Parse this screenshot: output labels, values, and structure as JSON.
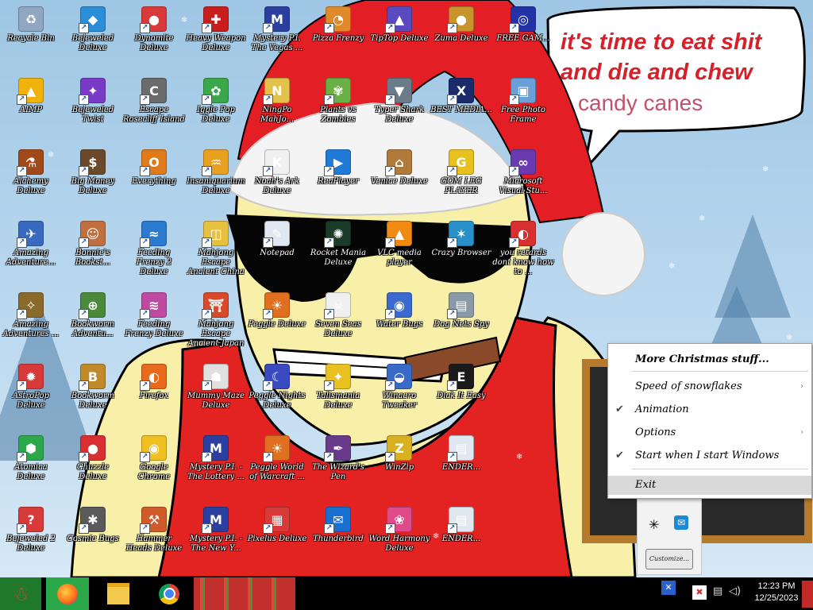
{
  "desktop": {
    "icons": [
      {
        "label": "Recycle Bin",
        "icon": "recycle-bin-icon",
        "color": "#8fa7c0",
        "glyph": "♻"
      },
      {
        "label": "Bejeweled Deluxe",
        "icon": "bejeweled-icon",
        "color": "#2a8fd8",
        "glyph": "◆"
      },
      {
        "label": "Dynomite Deluxe",
        "icon": "dynomite-icon",
        "color": "#d83a3a",
        "glyph": "●"
      },
      {
        "label": "Heavy Weapon Deluxe",
        "icon": "heavy-weapon-icon",
        "color": "#c81e1e",
        "glyph": "✚"
      },
      {
        "label": "Mystery P.I. The Vegas ...",
        "icon": "mystery-pi-icon",
        "color": "#2b3fa0",
        "glyph": "M"
      },
      {
        "label": "Pizza Frenzy",
        "icon": "pizza-icon",
        "color": "#e08a2a",
        "glyph": "◔"
      },
      {
        "label": "TipTop Deluxe",
        "icon": "tiptop-icon",
        "color": "#5a4ac0",
        "glyph": "▲"
      },
      {
        "label": "Zuma Deluxe",
        "icon": "zuma-icon",
        "color": "#c9942b",
        "glyph": "●"
      },
      {
        "label": "FREE GAM...",
        "icon": "free-games-icon",
        "color": "#2432a8",
        "glyph": "◎"
      },
      {
        "label": "AIMP",
        "icon": "aimp-icon",
        "color": "#f2b20c",
        "glyph": "▲"
      },
      {
        "label": "Bejeweled Twist",
        "icon": "bejeweled-twist-icon",
        "color": "#7a3ac8",
        "glyph": "✦"
      },
      {
        "label": "Escape Rosecliff Island",
        "icon": "escape-rosecliff-icon",
        "color": "#6b6b6b",
        "glyph": "C"
      },
      {
        "label": "Iggle Pop Deluxe",
        "icon": "iggle-pop-icon",
        "color": "#3aa84a",
        "glyph": "✿"
      },
      {
        "label": "NingPo MahJo...",
        "icon": "ningpo-icon",
        "color": "#e4c14a",
        "glyph": "N"
      },
      {
        "label": "Plants vs Zombies",
        "icon": "plants-zombies-icon",
        "color": "#6bb044",
        "glyph": "✾"
      },
      {
        "label": "Typer Shark Deluxe",
        "icon": "typer-shark-icon",
        "color": "#6a7b8a",
        "glyph": "▼"
      },
      {
        "label": "BEST MEDIA...",
        "icon": "xm-player-icon",
        "color": "#1a2a6a",
        "glyph": "X"
      },
      {
        "label": "Free Photo Frame",
        "icon": "photo-frame-icon",
        "color": "#6aa0d8",
        "glyph": "▣"
      },
      {
        "label": "Alchemy Deluxe",
        "icon": "alchemy-icon",
        "color": "#a04a1a",
        "glyph": "⚗"
      },
      {
        "label": "Big Money Deluxe",
        "icon": "big-money-icon",
        "color": "#6a4a2a",
        "glyph": "$"
      },
      {
        "label": "Everything",
        "icon": "everything-icon",
        "color": "#e07a1a",
        "glyph": "O"
      },
      {
        "label": "Insaniquarium Deluxe",
        "icon": "insaniquarium-icon",
        "color": "#e8a020",
        "glyph": "♒"
      },
      {
        "label": "Noah's Ark Deluxe",
        "icon": "noahs-ark-icon",
        "color": "#f0f0f0",
        "glyph": "K"
      },
      {
        "label": "ReaPlayer",
        "icon": "realplayer-icon",
        "color": "#1f7ad8",
        "glyph": "▶"
      },
      {
        "label": "Venice Deluxe",
        "icon": "venice-icon",
        "color": "#b07a3a",
        "glyph": "⌂"
      },
      {
        "label": "GOM LEG PLAYER",
        "icon": "gom-player-icon",
        "color": "#e8c020",
        "glyph": "G"
      },
      {
        "label": "Microsoft Visual Stu...",
        "icon": "visual-studio-icon",
        "color": "#6a3ab0",
        "glyph": "∞"
      },
      {
        "label": "Amazing Adventure...",
        "icon": "amazing-adventures-icon",
        "color": "#3a6ac0",
        "glyph": "✈"
      },
      {
        "label": "Bonnie's Bookst...",
        "icon": "bonnies-bookstore-icon",
        "color": "#c07040",
        "glyph": "☺"
      },
      {
        "label": "Feeding Frenzy 2 Deluxe",
        "icon": "feeding-frenzy-2-icon",
        "color": "#2a7ad0",
        "glyph": "≈"
      },
      {
        "label": "Mahjong Escape Ancient China",
        "icon": "mahjong-china-icon",
        "color": "#e8c040",
        "glyph": "◫"
      },
      {
        "label": "Notepad",
        "icon": "notepad-icon",
        "color": "#dfe8f0",
        "glyph": "✎"
      },
      {
        "label": "Rocket Mania Deluxe",
        "icon": "rocket-mania-icon",
        "color": "#1a3a2a",
        "glyph": "✺"
      },
      {
        "label": "VLC media player",
        "icon": "vlc-icon",
        "color": "#f08a10",
        "glyph": "▲"
      },
      {
        "label": "Crazy Browser",
        "icon": "crazy-browser-icon",
        "color": "#2a90c8",
        "glyph": "✶"
      },
      {
        "label": "you retards dont know how to ...",
        "icon": "firefox-shortcut-icon",
        "color": "#d83030",
        "glyph": "◐"
      },
      {
        "label": "Amazing Adventures ...",
        "icon": "amazing-adventures-2-icon",
        "color": "#8a6a2a",
        "glyph": "✧"
      },
      {
        "label": "Bookworm Adventu...",
        "icon": "bookworm-adventures-icon",
        "color": "#4a8a3a",
        "glyph": "⊕"
      },
      {
        "label": "Feeding Frenzy Deluxe",
        "icon": "feeding-frenzy-icon",
        "color": "#c04aa0",
        "glyph": "≋"
      },
      {
        "label": "Mahjong Escape Ancient Japan",
        "icon": "mahjong-japan-icon",
        "color": "#d84a2a",
        "glyph": "⛩"
      },
      {
        "label": "Peggle Deluxe",
        "icon": "peggle-icon",
        "color": "#e07020",
        "glyph": "☀"
      },
      {
        "label": "Seven Seas Deluxe",
        "icon": "seven-seas-icon",
        "color": "#f0f0f0",
        "glyph": "☠"
      },
      {
        "label": "Water Bugs",
        "icon": "water-bugs-icon",
        "color": "#3a6ad0",
        "glyph": "◉"
      },
      {
        "label": "Dog Nets Spy",
        "icon": "dog-nets-icon",
        "color": "#8a9aa8",
        "glyph": "▤"
      },
      {
        "label": "",
        "icon": "blank-icon",
        "color": "transparent",
        "glyph": ""
      },
      {
        "label": "AstroPop Deluxe",
        "icon": "astropop-icon",
        "color": "#d83a3a",
        "glyph": "✹"
      },
      {
        "label": "Bookworm Deluxe",
        "icon": "bookworm-icon",
        "color": "#c08a2a",
        "glyph": "B"
      },
      {
        "label": "Firefox",
        "icon": "firefox-icon",
        "color": "#e86a1a",
        "glyph": "◐"
      },
      {
        "label": "Mummy Maze Deluxe",
        "icon": "mummy-maze-icon",
        "color": "#e0e0e0",
        "glyph": "☗"
      },
      {
        "label": "Peggle Nights Deluxe",
        "icon": "peggle-nights-icon",
        "color": "#3a4ac0",
        "glyph": "☾"
      },
      {
        "label": "Talismania Deluxe",
        "icon": "talismania-icon",
        "color": "#e8c020",
        "glyph": "✦"
      },
      {
        "label": "Winaero Tweaker",
        "icon": "winaero-icon",
        "color": "#3a6ac8",
        "glyph": "◒"
      },
      {
        "label": "Dick It Easy",
        "icon": "dick-it-easy-icon",
        "color": "#1a1a1a",
        "glyph": "E"
      },
      {
        "label": "",
        "icon": "blank-icon",
        "color": "transparent",
        "glyph": ""
      },
      {
        "label": "Atomica Deluxe",
        "icon": "atomica-icon",
        "color": "#2aa84a",
        "glyph": "⬢"
      },
      {
        "label": "Chuzzle Deluxe",
        "icon": "chuzzle-icon",
        "color": "#d83030",
        "glyph": "●"
      },
      {
        "label": "Google Chrome",
        "icon": "chrome-icon",
        "color": "#f0c020",
        "glyph": "◉"
      },
      {
        "label": "Mystery P.I. - The Lottery ...",
        "icon": "mystery-pi-lottery-icon",
        "color": "#2b3fa0",
        "glyph": "M"
      },
      {
        "label": "Peggle World of Warcraft ...",
        "icon": "peggle-wow-icon",
        "color": "#e07020",
        "glyph": "☀"
      },
      {
        "label": "The Wizard's Pen",
        "icon": "wizards-pen-icon",
        "color": "#6a3a8a",
        "glyph": "✒"
      },
      {
        "label": "WinZip",
        "icon": "winzip-icon",
        "color": "#d8b020",
        "glyph": "Z"
      },
      {
        "label": "ENDER...",
        "icon": "ender-icon",
        "color": "#dfe8f0",
        "glyph": "▤"
      },
      {
        "label": "",
        "icon": "blank-icon",
        "color": "transparent",
        "glyph": ""
      },
      {
        "label": "Bejeweled 2 Deluxe",
        "icon": "bejeweled-2-icon",
        "color": "#d83a3a",
        "glyph": "?"
      },
      {
        "label": "Cosmic Bugs",
        "icon": "cosmic-bugs-icon",
        "color": "#5a5a5a",
        "glyph": "✱"
      },
      {
        "label": "Hammer Heads Deluxe",
        "icon": "hammer-heads-icon",
        "color": "#d05a2a",
        "glyph": "⚒"
      },
      {
        "label": "Mystery P.I. - The New Y...",
        "icon": "mystery-pi-newyork-icon",
        "color": "#2b3fa0",
        "glyph": "M"
      },
      {
        "label": "Pixelus Deluxe",
        "icon": "pixelus-icon",
        "color": "#d83a3a",
        "glyph": "▦"
      },
      {
        "label": "Thunderbird",
        "icon": "thunderbird-icon",
        "color": "#1a70d0",
        "glyph": "✉"
      },
      {
        "label": "Word Harmony Deluxe",
        "icon": "word-harmony-icon",
        "color": "#e04a8a",
        "glyph": "❀"
      },
      {
        "label": "ENDER...",
        "icon": "ender-2-icon",
        "color": "#dfe8f0",
        "glyph": "▤"
      },
      {
        "label": "",
        "icon": "blank-icon",
        "color": "transparent",
        "glyph": ""
      }
    ]
  },
  "meme": {
    "line1": "it's time to eat shit",
    "line2": "and die and chew",
    "line3": "candy canes"
  },
  "context_menu": {
    "items": [
      {
        "label": "More Christmas stuff...",
        "checked": false,
        "submenu": false,
        "bold": true
      },
      {
        "label": "Speed of snowflakes",
        "checked": false,
        "submenu": true
      },
      {
        "label": "Animation",
        "checked": true,
        "submenu": false
      },
      {
        "label": "Options",
        "checked": false,
        "submenu": true
      },
      {
        "label": "Start when I start Windows",
        "checked": true,
        "submenu": false
      },
      {
        "label": "Exit",
        "checked": false,
        "submenu": false,
        "highlighted": true
      }
    ],
    "check_glyph": "✔",
    "submenu_glyph": "›"
  },
  "tray_flyout": {
    "customize_label": "Customize..."
  },
  "taskbar": {
    "start_icon": "santa-start-icon",
    "pinned": [
      {
        "name": "firefox-taskbar-icon"
      },
      {
        "name": "file-explorer-taskbar-icon"
      },
      {
        "name": "chrome-taskbar-icon"
      }
    ],
    "clock_time": "12:23 PM",
    "clock_date": "12/25/2023"
  }
}
